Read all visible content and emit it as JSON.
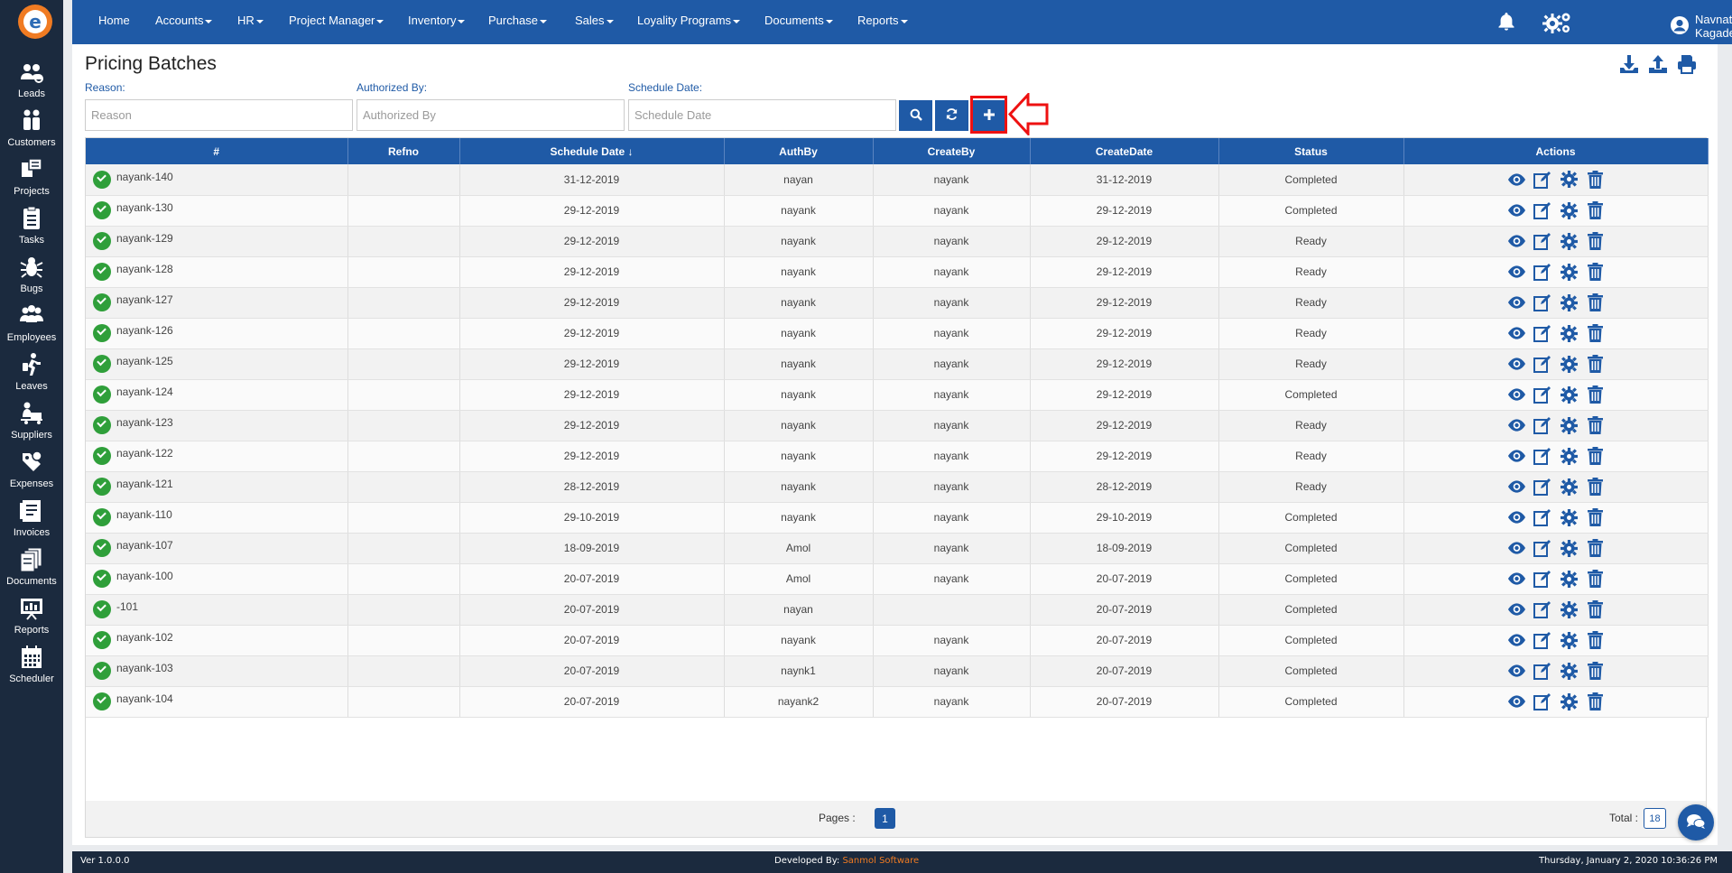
{
  "nav": {
    "items": [
      {
        "label": "Home",
        "dropdown": false
      },
      {
        "label": "Accounts",
        "dropdown": true
      },
      {
        "label": "HR",
        "dropdown": true
      },
      {
        "label": "Project Manager",
        "dropdown": true
      },
      {
        "label": "Inventory",
        "dropdown": true
      },
      {
        "label": "Purchase",
        "dropdown": true
      },
      {
        "label": "Sales",
        "dropdown": true
      },
      {
        "label": "Loyality Programs",
        "dropdown": true
      },
      {
        "label": "Documents",
        "dropdown": true
      },
      {
        "label": "Reports",
        "dropdown": true
      }
    ],
    "user_name": "Navnath Kagade"
  },
  "sidebar": {
    "items": [
      {
        "label": "Leads",
        "icon": "leads-icon"
      },
      {
        "label": "Customers",
        "icon": "customers-icon"
      },
      {
        "label": "Projects",
        "icon": "projects-icon"
      },
      {
        "label": "Tasks",
        "icon": "tasks-icon"
      },
      {
        "label": "Bugs",
        "icon": "bug-icon"
      },
      {
        "label": "Employees",
        "icon": "employees-icon"
      },
      {
        "label": "Leaves",
        "icon": "leaves-icon"
      },
      {
        "label": "Suppliers",
        "icon": "suppliers-icon"
      },
      {
        "label": "Expenses",
        "icon": "expenses-icon"
      },
      {
        "label": "Invoices",
        "icon": "invoices-icon"
      },
      {
        "label": "Documents",
        "icon": "documents-icon"
      },
      {
        "label": "Reports",
        "icon": "reports-icon"
      },
      {
        "label": "Scheduler",
        "icon": "calendar-icon"
      }
    ]
  },
  "page": {
    "title": "Pricing Batches"
  },
  "filters": {
    "reason_label": "Reason:",
    "reason_placeholder": "Reason",
    "authorized_label": "Authorized By:",
    "authorized_placeholder": "Authorized By",
    "schedule_label": "Schedule Date:",
    "schedule_placeholder": "Schedule Date"
  },
  "table": {
    "columns": [
      "#",
      "Refno",
      "Schedule Date",
      "AuthBy",
      "CreateBy",
      "CreateDate",
      "Status",
      "Actions"
    ],
    "sort_indicator": "↓",
    "rows": [
      {
        "ref": "nayank-140",
        "refno": "",
        "schedule": "31-12-2019",
        "auth": "nayan",
        "create_by": "nayank",
        "create_date": "31-12-2019",
        "status": "Completed"
      },
      {
        "ref": "nayank-130",
        "refno": "",
        "schedule": "29-12-2019",
        "auth": "nayank",
        "create_by": "nayank",
        "create_date": "29-12-2019",
        "status": "Completed"
      },
      {
        "ref": "nayank-129",
        "refno": "",
        "schedule": "29-12-2019",
        "auth": "nayank",
        "create_by": "nayank",
        "create_date": "29-12-2019",
        "status": "Ready"
      },
      {
        "ref": "nayank-128",
        "refno": "",
        "schedule": "29-12-2019",
        "auth": "nayank",
        "create_by": "nayank",
        "create_date": "29-12-2019",
        "status": "Ready"
      },
      {
        "ref": "nayank-127",
        "refno": "",
        "schedule": "29-12-2019",
        "auth": "nayank",
        "create_by": "nayank",
        "create_date": "29-12-2019",
        "status": "Ready"
      },
      {
        "ref": "nayank-126",
        "refno": "",
        "schedule": "29-12-2019",
        "auth": "nayank",
        "create_by": "nayank",
        "create_date": "29-12-2019",
        "status": "Ready"
      },
      {
        "ref": "nayank-125",
        "refno": "",
        "schedule": "29-12-2019",
        "auth": "nayank",
        "create_by": "nayank",
        "create_date": "29-12-2019",
        "status": "Ready"
      },
      {
        "ref": "nayank-124",
        "refno": "",
        "schedule": "29-12-2019",
        "auth": "nayank",
        "create_by": "nayank",
        "create_date": "29-12-2019",
        "status": "Completed"
      },
      {
        "ref": "nayank-123",
        "refno": "",
        "schedule": "29-12-2019",
        "auth": "nayank",
        "create_by": "nayank",
        "create_date": "29-12-2019",
        "status": "Ready"
      },
      {
        "ref": "nayank-122",
        "refno": "",
        "schedule": "29-12-2019",
        "auth": "nayank",
        "create_by": "nayank",
        "create_date": "29-12-2019",
        "status": "Ready"
      },
      {
        "ref": "nayank-121",
        "refno": "",
        "schedule": "28-12-2019",
        "auth": "nayank",
        "create_by": "nayank",
        "create_date": "28-12-2019",
        "status": "Ready"
      },
      {
        "ref": "nayank-110",
        "refno": "",
        "schedule": "29-10-2019",
        "auth": "nayank",
        "create_by": "nayank",
        "create_date": "29-10-2019",
        "status": "Completed"
      },
      {
        "ref": "nayank-107",
        "refno": "",
        "schedule": "18-09-2019",
        "auth": "Amol",
        "create_by": "nayank",
        "create_date": "18-09-2019",
        "status": "Completed"
      },
      {
        "ref": "nayank-100",
        "refno": "",
        "schedule": "20-07-2019",
        "auth": "Amol",
        "create_by": "nayank",
        "create_date": "20-07-2019",
        "status": "Completed"
      },
      {
        "ref": "-101",
        "refno": "",
        "schedule": "20-07-2019",
        "auth": "nayan",
        "create_by": "",
        "create_date": "20-07-2019",
        "status": "Completed"
      },
      {
        "ref": "nayank-102",
        "refno": "",
        "schedule": "20-07-2019",
        "auth": "nayank",
        "create_by": "nayank",
        "create_date": "20-07-2019",
        "status": "Completed"
      },
      {
        "ref": "nayank-103",
        "refno": "",
        "schedule": "20-07-2019",
        "auth": "naynk1",
        "create_by": "nayank",
        "create_date": "20-07-2019",
        "status": "Completed"
      },
      {
        "ref": "nayank-104",
        "refno": "",
        "schedule": "20-07-2019",
        "auth": "nayank2",
        "create_by": "nayank",
        "create_date": "20-07-2019",
        "status": "Completed"
      }
    ]
  },
  "pager": {
    "pages_label": "Pages :",
    "current_page": "1",
    "total_label": "Total :",
    "total": "18"
  },
  "footer": {
    "version": "Ver 1.0.0.0",
    "developed_by": "Developed By:",
    "brand": "Sanmol Software",
    "datetime": "Thursday, January 2, 2020 10:36:26 PM"
  },
  "colors": {
    "primary": "#1f5aa6",
    "sidebar": "#1b2a3e",
    "accent": "#f07b22",
    "success": "#2f9f3a",
    "highlight": "#e11111"
  }
}
